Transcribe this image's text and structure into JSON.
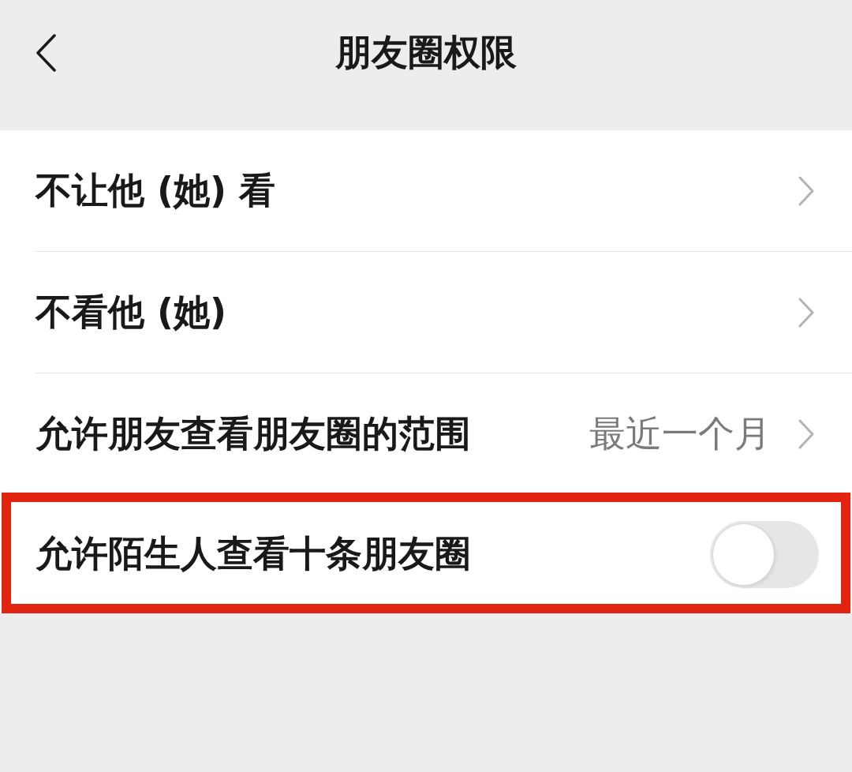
{
  "header": {
    "title": "朋友圈权限"
  },
  "rows": [
    {
      "kind": "link",
      "label": "不让他 (她) 看",
      "highlighted": false
    },
    {
      "kind": "link",
      "label": "不看他 (她)",
      "highlighted": false
    },
    {
      "kind": "link",
      "label": "允许朋友查看朋友圈的范围",
      "value": "最近一个月",
      "highlighted": false
    },
    {
      "kind": "switch",
      "label": "允许陌生人查看十条朋友圈",
      "on": false,
      "highlighted": true
    }
  ]
}
